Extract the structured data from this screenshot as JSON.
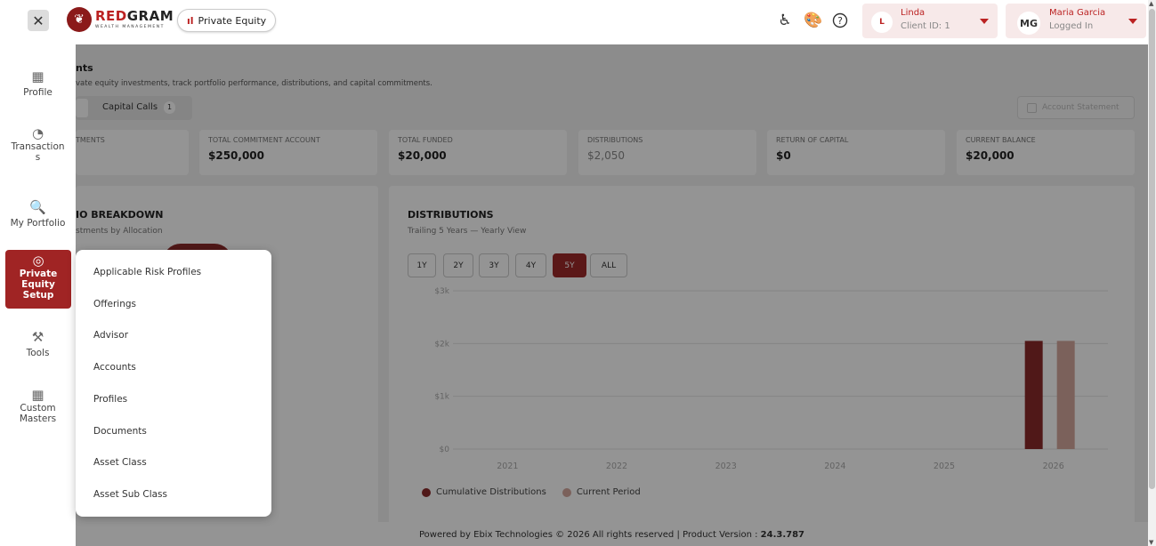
{
  "header": {
    "brand_name_red": "RED",
    "brand_name_rest": "GRAM",
    "brand_sub": "WEALTH MANAGEMENT",
    "module_label": "Private Equity",
    "client": {
      "initial": "L",
      "name": "Linda",
      "sub": "Client ID: 1"
    },
    "user": {
      "initials": "MG",
      "name": "Maria Garcia",
      "sub": "Logged In"
    }
  },
  "sidebar": {
    "items": [
      {
        "label": "Profile",
        "icon": "grid-icon"
      },
      {
        "label": "Transaction\ns",
        "icon": "pie-icon"
      },
      {
        "label": "My Portfolio",
        "icon": "portfolio-search-icon"
      },
      {
        "label": "Private Equity Setup",
        "icon": "target-icon"
      },
      {
        "label": "Tools",
        "icon": "tools-icon"
      },
      {
        "label": "Custom Masters",
        "icon": "grid-icon"
      }
    ]
  },
  "main": {
    "title": "nts",
    "description": "vate equity investments, track portfolio performance, distributions, and capital commitments.",
    "tab_label": "Capital Calls",
    "tab_badge": "1",
    "account_statement": "Account Statement",
    "stats": [
      {
        "label": "TMENTS",
        "value": ""
      },
      {
        "label": "TOTAL COMMITMENT ACCOUNT",
        "value": "$250,000"
      },
      {
        "label": "TOTAL FUNDED",
        "value": "$20,000"
      },
      {
        "label": "DISTRIBUTIONS",
        "value": "$2,050"
      },
      {
        "label": "RETURN OF CAPITAL",
        "value": "$0"
      },
      {
        "label": "CURRENT BALANCE",
        "value": "$20,000"
      }
    ],
    "breakdown": {
      "title": "IO BREAKDOWN",
      "subtitle": "stments by Allocation"
    },
    "distributions": {
      "title": "DISTRIBUTIONS",
      "subtitle": "Trailing 5 Years — Yearly View",
      "ranges": [
        "1Y",
        "2Y",
        "3Y",
        "4Y",
        "5Y",
        "ALL"
      ],
      "active_range": "5Y",
      "legend": [
        "Cumulative Distributions",
        "Current Period"
      ]
    }
  },
  "menu": {
    "items": [
      "Applicable Risk Profiles",
      "Offerings",
      "Advisor",
      "Accounts",
      "Profiles",
      "Documents",
      "Asset Class",
      "Asset Sub Class"
    ]
  },
  "footer": {
    "text": "Powered by Ebix Technologies © 2026 All rights reserved | Product Version : ",
    "version": "24.3.787"
  },
  "colors": {
    "accent": "#a02424",
    "cumulative": "#8b2a2a",
    "current": "#d4a79e"
  },
  "chart_data": {
    "type": "bar",
    "title": "DISTRIBUTIONS",
    "categories": [
      "2021",
      "2022",
      "2023",
      "2024",
      "2025",
      "2026"
    ],
    "y_ticks": [
      "$0",
      "$1k",
      "$2k",
      "$3k"
    ],
    "ylim": [
      0,
      3000
    ],
    "series": [
      {
        "name": "Cumulative Distributions",
        "values": [
          0,
          0,
          0,
          0,
          0,
          2050
        ]
      },
      {
        "name": "Current Period",
        "values": [
          0,
          0,
          0,
          0,
          0,
          2050
        ]
      }
    ],
    "grid": true,
    "legend_position": "bottom-left"
  }
}
